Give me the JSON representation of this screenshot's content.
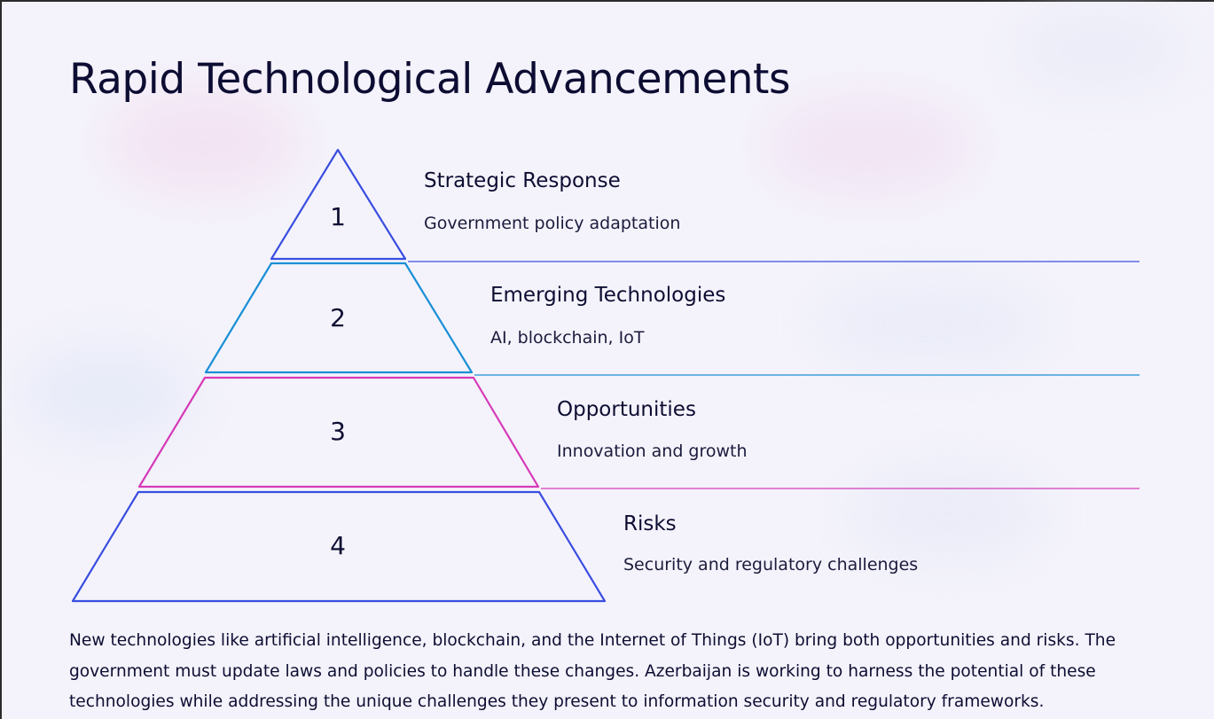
{
  "slide": {
    "title": "Rapid Technological Advancements",
    "body": "New technologies like artificial intelligence, blockchain, and the Internet of Things (IoT) bring both opportunities and risks. The government must update laws and policies to handle these changes. Azerbaijan is working to harness the potential of these technologies while addressing the unique challenges they present to information security and regulatory frameworks."
  },
  "pyramid": {
    "levels": [
      {
        "number": "1",
        "title": "Strategic Response",
        "description": "Government policy adaptation",
        "color": "#3a4ee0"
      },
      {
        "number": "2",
        "title": "Emerging Technologies",
        "description": "AI, blockchain, IoT",
        "color": "#1a8fd6"
      },
      {
        "number": "3",
        "title": "Opportunities",
        "description": "Innovation and growth",
        "color": "#d63ab8"
      },
      {
        "number": "4",
        "title": "Risks",
        "description": "Security and regulatory challenges",
        "color": "#3a4ee0"
      }
    ]
  }
}
